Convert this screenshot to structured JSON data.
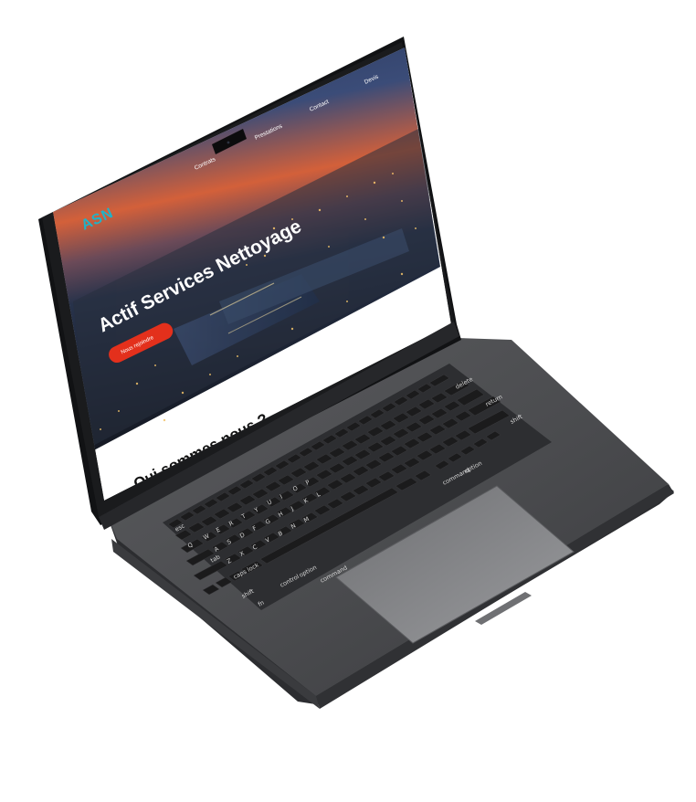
{
  "website": {
    "brand": "ASN",
    "nav": {
      "contrats": "Contrats",
      "prestations": "Prestations",
      "contact": "Contact",
      "devis": "Devis"
    },
    "hero_title": "Actif Services Nettoyage",
    "cta_label": "Nous rejoindre",
    "section_heading": "Qui sommes nous ?"
  },
  "keyboard": {
    "labels": {
      "delete": "delete",
      "return": "return",
      "shift_right": "shift",
      "command_right": "command",
      "option_right": "option",
      "command_left": "command",
      "option_left": "option",
      "control": "control",
      "caps_lock": "caps lock",
      "tab": "tab",
      "shift_left": "shift",
      "esc": "esc",
      "fn": "fn"
    },
    "keys": {
      "key_q": "Q",
      "key_w": "W",
      "key_e": "E",
      "key_r": "R",
      "key_t": "T",
      "key_y": "Y",
      "key_u": "U",
      "key_i": "I",
      "key_o": "O",
      "key_p": "P",
      "key_a": "A",
      "key_s": "S",
      "key_d": "D",
      "key_f": "F",
      "key_g": "G",
      "key_h": "H",
      "key_j": "J",
      "key_k": "K",
      "key_l": "L",
      "key_z": "Z",
      "key_x": "X",
      "key_c": "C",
      "key_v": "V",
      "key_b": "B",
      "key_n": "N",
      "key_m": "M"
    }
  },
  "colors": {
    "brand_accent": "#1fb3c9",
    "cta_red": "#e3301c",
    "laptop_body": "#4a4b4e",
    "key_cap": "#1b1b1c"
  }
}
